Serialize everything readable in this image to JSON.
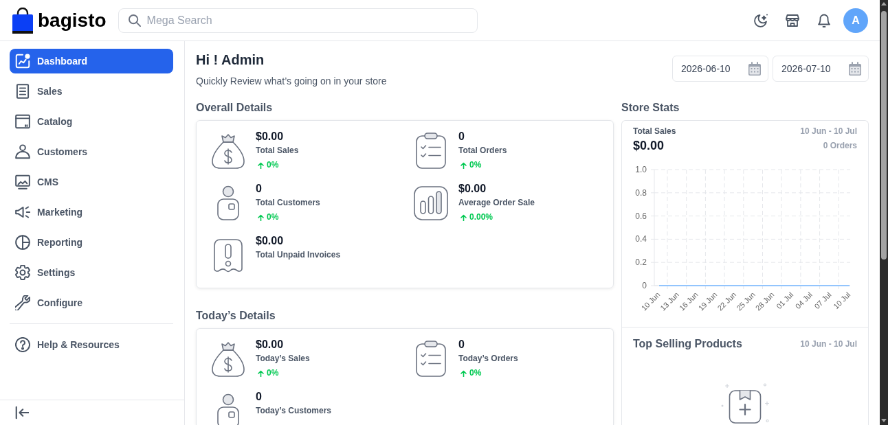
{
  "header": {
    "logo": "bagisto",
    "search": {
      "placeholder": "Mega Search"
    },
    "avatar": "A"
  },
  "sidebar": {
    "items": [
      {
        "label": "Dashboard",
        "selected": true
      },
      {
        "label": "Sales",
        "selected": false
      },
      {
        "label": "Catalog",
        "selected": false
      },
      {
        "label": "Customers",
        "selected": false
      },
      {
        "label": "CMS",
        "selected": false
      },
      {
        "label": "Marketing",
        "selected": false
      },
      {
        "label": "Reporting",
        "selected": false
      },
      {
        "label": "Settings",
        "selected": false
      },
      {
        "label": "Configure",
        "selected": false
      }
    ],
    "footer_items": [
      {
        "label": "Help & Resources",
        "selected": false
      }
    ]
  },
  "page": {
    "title": "Hi ! Admin",
    "subtitle": "Quickly Review what’s going on in your store",
    "date_range": {
      "from": "2026-06-10",
      "to": "2026-07-10"
    }
  },
  "overall_details": {
    "title": "Overall Details",
    "stats": [
      {
        "kind": "sales",
        "value": "$0.00",
        "label": "Total Sales",
        "change": "0%",
        "rising": true
      },
      {
        "kind": "orders",
        "value": "0",
        "label": "Total Orders",
        "change": "0%",
        "rising": true
      },
      {
        "kind": "customers",
        "value": "0",
        "label": "Total Customers",
        "change": "0%",
        "rising": true
      },
      {
        "kind": "average",
        "value": "$0.00",
        "label": "Average Order Sale",
        "change": "0.00%",
        "rising": true
      },
      {
        "kind": "invoices",
        "value": "$0.00",
        "label": "Total Unpaid Invoices"
      }
    ]
  },
  "todays_details": {
    "title": "Today’s Details",
    "stats": [
      {
        "kind": "sales",
        "value": "$0.00",
        "label": "Today’s Sales",
        "change": "0%",
        "rising": true
      },
      {
        "kind": "orders",
        "value": "0",
        "label": "Today’s Orders",
        "change": "0%",
        "rising": true
      },
      {
        "kind": "customers",
        "value": "0",
        "label": "Today’s Customers"
      }
    ]
  },
  "store_stats": {
    "title": "Store Stats",
    "total_sales": {
      "label": "Total Sales",
      "value": "$0.00",
      "date_range": "10 Jun - 10 Jul",
      "orders": "0 Orders",
      "chart_data": {
        "type": "line",
        "categories": [
          "10 Jun",
          "13 Jun",
          "16 Jun",
          "19 Jun",
          "22 Jun",
          "25 Jun",
          "28 Jun",
          "01 Jul",
          "04 Jul",
          "07 Jul",
          "10 Jul"
        ],
        "series": [
          {
            "color": "#93c5fd",
            "values": [
              0,
              0,
              0,
              0,
              0,
              0,
              0,
              0,
              0,
              0,
              0
            ]
          }
        ],
        "ylim": [
          0,
          1
        ],
        "yticks": [
          0,
          0.2,
          0.4,
          0.6,
          0.8,
          {
            "value": 1,
            "label": "1.0"
          }
        ],
        "grid": true
      }
    },
    "top_selling_products": {
      "title": "Top Selling Products",
      "date_range": "10 Jun - 10 Jul"
    }
  }
}
